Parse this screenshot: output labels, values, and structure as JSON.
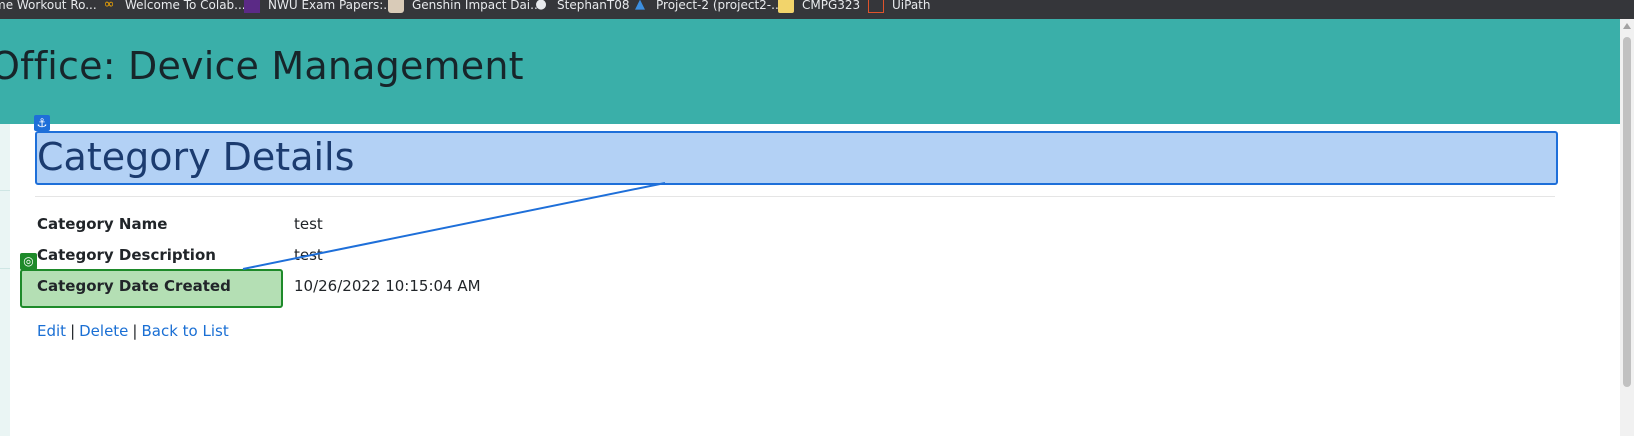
{
  "bookmarks": [
    {
      "label": "me Workout Ro...",
      "icon": "workout-icon"
    },
    {
      "label": "Welcome To Colab...",
      "icon": "colab-icon"
    },
    {
      "label": "NWU Exam Papers:...",
      "icon": "nwu-icon"
    },
    {
      "label": "Genshin Impact Dai...",
      "icon": "genshin-icon"
    },
    {
      "label": "StephanT08",
      "icon": "github-icon"
    },
    {
      "label": "Project-2 (project2-...",
      "icon": "azure-icon"
    },
    {
      "label": "CMPG323",
      "icon": "folder-icon"
    },
    {
      "label": "UiPath",
      "icon": "uipath-icon"
    }
  ],
  "header": {
    "title": "Office: Device Management"
  },
  "page": {
    "heading": "Category Details"
  },
  "details": [
    {
      "label": "Category Name",
      "value": "test"
    },
    {
      "label": "Category Description",
      "value": "test"
    },
    {
      "label": "Category Date Created",
      "value": "10/26/2022 10:15:04 AM"
    }
  ],
  "actions": {
    "edit": "Edit",
    "delete": "Delete",
    "back": "Back to List",
    "separator": "|"
  },
  "overlay": {
    "anchor_icon": "anchor-icon",
    "target_icon": "target-icon",
    "anchor_color": "#1e6fd9",
    "target_color": "#1e8a2a"
  }
}
